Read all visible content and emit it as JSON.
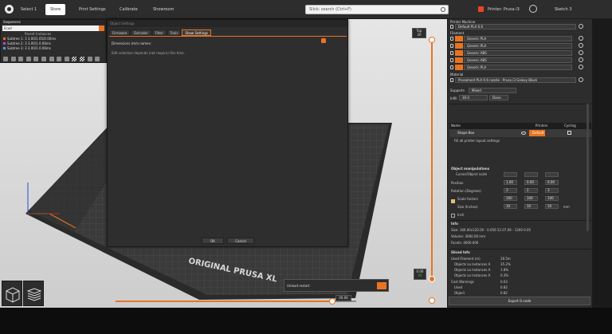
{
  "topbar": {
    "tabs": [
      "Select 1",
      "Store",
      "Print Settings",
      "Calibrate",
      "Showroom"
    ],
    "search_placeholder": "Slick: search (Ctrl+F)",
    "right_items": [
      "Printer: Prusa i3",
      "Sketch 3"
    ]
  },
  "objects": {
    "title": "Sequences",
    "search_value": "Ecad",
    "column": "Parent Instances",
    "rows": [
      {
        "label": "Subtree 1: 3  3.00/1.05/0.06ms",
        "color": "#e87422"
      },
      {
        "label": "Subtree 2: 3  3.00/1.0.06ms",
        "color": "#d13bd6"
      },
      {
        "label": "Subtree 3: 3  3.00/1.0.06ms",
        "color": "#3ca9e8"
      }
    ]
  },
  "dialog": {
    "title": "Object Settings",
    "tabs": [
      "Firmware",
      "Extruder",
      "Filter",
      "Tools",
      "Show Settings"
    ],
    "active_tab": 4,
    "field_label": "Dimensions (mm names:",
    "help": "Edit selection depends (not require) this time.",
    "ok_label": "OK",
    "cancel_label": "Cancel"
  },
  "bed_label": "ORIGINAL PRUSA XL",
  "slider": {
    "top_label": "Top",
    "top_value": "20",
    "bottom_value": "0.00",
    "bottom_sub": "00",
    "h_value": "00.00"
  },
  "toast": {
    "text": "Unload restart"
  },
  "sidebar": {
    "printer_label": "Printer Machine",
    "printer_value": "Default PLA 0.6",
    "filament_label": "Filament",
    "filaments": [
      "Generic PLA",
      "Generic PLA",
      "Generic ABS",
      "Generic ABS",
      "Generic PLA"
    ],
    "material_label": "Material",
    "material_value": "Prusament PLA 0.6 nozzle - Prusa i3 Galaxy Black",
    "supports_label": "Supports",
    "supports_value": "Mixed",
    "infill_label": "Infill",
    "infill_value": "30.0",
    "infill_extra": "Done",
    "table_headers": [
      "Name",
      "Printers",
      "Cycling"
    ],
    "row_name": "Shape Box",
    "row_action": "Default",
    "row_sub": "Fill all printer layout settings",
    "object_section": "Object manipulations",
    "grid_col_header": "Cursor/Object scale",
    "grid_labels": [
      "Position",
      "Rotation (Degrees)",
      "Scale factors",
      "Size (Inches)",
      "Inch"
    ],
    "grid_values": [
      [
        "1.00",
        "0.00",
        "0.00"
      ],
      [
        "3",
        "2",
        "3"
      ],
      [
        "100",
        "100",
        "100"
      ],
      [
        "10",
        "10",
        "10"
      ]
    ],
    "size_note": "mm",
    "info_section": "Info",
    "info_lines": [
      "Size: 160.00x120.00 - 0.056 52.07.09 - 1200 0.05",
      "Volume: 3060.00 mm",
      "Facets: 4000.000"
    ],
    "stats_section": "Sliced Info",
    "stats_lines": [
      [
        "Used Filament (m)",
        "28.5m"
      ],
      [
        "Objects  Lo Instances A",
        "35.2%"
      ],
      [
        "Objects  Lo Instances A",
        "1.8%"
      ],
      [
        "Objects  Lo Instances A",
        "0.3%"
      ],
      [
        "Cost Warnings",
        "0.03"
      ],
      [
        "Used",
        "0.82"
      ],
      [
        "Object",
        "0.82"
      ]
    ],
    "slice_label": "Export G-code"
  }
}
